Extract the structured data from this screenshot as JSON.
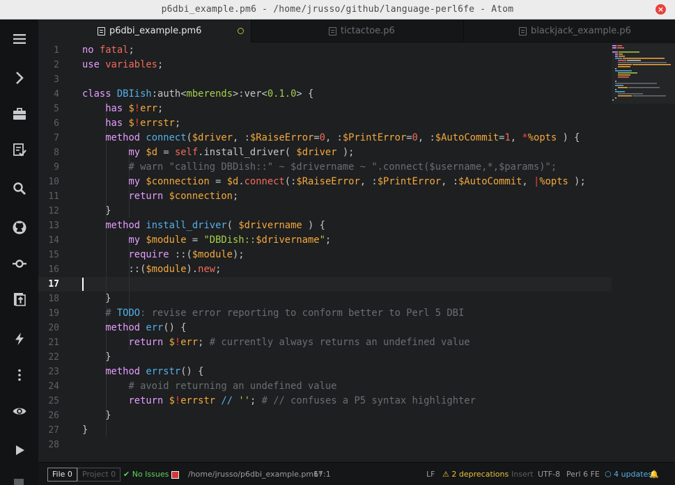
{
  "window": {
    "title": "p6dbi_example.pm6 - /home/jrusso/github/language-perl6fe - Atom"
  },
  "tabs": [
    {
      "label": "p6dbi_example.pm6"
    },
    {
      "label": "tictactoe.p6"
    },
    {
      "label": "blackjack_example.p6"
    }
  ],
  "editor": {
    "cursor_line": 17,
    "line_numbers": [
      "1",
      "2",
      "3",
      "4",
      "5",
      "6",
      "7",
      "8",
      "9",
      "10",
      "11",
      "12",
      "13",
      "14",
      "15",
      "16",
      "17",
      "18",
      "19",
      "20",
      "21",
      "22",
      "23",
      "24",
      "25",
      "26",
      "27",
      "28"
    ],
    "lines": [
      [
        [
          "k",
          "no"
        ],
        [
          "p",
          " "
        ],
        [
          "s",
          "fatal"
        ],
        [
          "p",
          ";"
        ]
      ],
      [
        [
          "k",
          "use"
        ],
        [
          "p",
          " "
        ],
        [
          "s",
          "variables"
        ],
        [
          "p",
          ";"
        ]
      ],
      [],
      [
        [
          "k",
          "class"
        ],
        [
          "p",
          " "
        ],
        [
          "t",
          "DBIish"
        ],
        [
          "p",
          ":auth<"
        ],
        [
          "g",
          "mberends"
        ],
        [
          "p",
          ">:ver<"
        ],
        [
          "g",
          "0.1.0"
        ],
        [
          "p",
          "> {"
        ]
      ],
      [
        [
          "p",
          "    "
        ],
        [
          "k",
          "has"
        ],
        [
          "p",
          " "
        ],
        [
          "v",
          "$"
        ],
        [
          "n",
          "!"
        ],
        [
          "v",
          "err"
        ],
        [
          "p",
          ";"
        ]
      ],
      [
        [
          "p",
          "    "
        ],
        [
          "k",
          "has"
        ],
        [
          "p",
          " "
        ],
        [
          "v",
          "$"
        ],
        [
          "n",
          "!"
        ],
        [
          "v",
          "errstr"
        ],
        [
          "p",
          ";"
        ]
      ],
      [
        [
          "p",
          "    "
        ],
        [
          "k",
          "method"
        ],
        [
          "p",
          " "
        ],
        [
          "f",
          "connect"
        ],
        [
          "p",
          "("
        ],
        [
          "v",
          "$driver"
        ],
        [
          "p",
          ", :"
        ],
        [
          "v",
          "$RaiseError"
        ],
        [
          "p",
          "="
        ],
        [
          "s",
          "0"
        ],
        [
          "p",
          ", :"
        ],
        [
          "v",
          "$PrintError"
        ],
        [
          "p",
          "="
        ],
        [
          "s",
          "0"
        ],
        [
          "p",
          ", :"
        ],
        [
          "v",
          "$AutoCommit"
        ],
        [
          "p",
          "="
        ],
        [
          "s",
          "1"
        ],
        [
          "p",
          ", "
        ],
        [
          "n",
          "*"
        ],
        [
          "v",
          "%opts"
        ],
        [
          "p",
          " ) {"
        ]
      ],
      [
        [
          "p",
          "        "
        ],
        [
          "k",
          "my"
        ],
        [
          "p",
          " "
        ],
        [
          "v",
          "$d"
        ],
        [
          "p",
          " = "
        ],
        [
          "s",
          "self"
        ],
        [
          "p",
          "."
        ],
        [
          "p",
          "install_driver( "
        ],
        [
          "v",
          "$driver"
        ],
        [
          "p",
          " );"
        ]
      ],
      [
        [
          "p",
          "        "
        ],
        [
          "c",
          "# warn \"calling DBDish::\" ~ $drivername ~ \".connect($username,*,$params)\";"
        ]
      ],
      [
        [
          "p",
          "        "
        ],
        [
          "k",
          "my"
        ],
        [
          "p",
          " "
        ],
        [
          "v",
          "$connection"
        ],
        [
          "p",
          " = "
        ],
        [
          "v",
          "$d"
        ],
        [
          "p",
          "."
        ],
        [
          "s",
          "connect"
        ],
        [
          "p",
          "(:"
        ],
        [
          "v",
          "$RaiseError"
        ],
        [
          "p",
          ", :"
        ],
        [
          "v",
          "$PrintError"
        ],
        [
          "p",
          ", :"
        ],
        [
          "v",
          "$AutoCommit"
        ],
        [
          "p",
          ", "
        ],
        [
          "n",
          "|"
        ],
        [
          "v",
          "%opts"
        ],
        [
          "p",
          " );"
        ]
      ],
      [
        [
          "p",
          "        "
        ],
        [
          "k",
          "return"
        ],
        [
          "p",
          " "
        ],
        [
          "v",
          "$connection"
        ],
        [
          "p",
          ";"
        ]
      ],
      [
        [
          "p",
          "    }"
        ]
      ],
      [
        [
          "p",
          "    "
        ],
        [
          "k",
          "method"
        ],
        [
          "p",
          " "
        ],
        [
          "f",
          "install_driver"
        ],
        [
          "p",
          "( "
        ],
        [
          "v",
          "$drivername"
        ],
        [
          "p",
          " ) {"
        ]
      ],
      [
        [
          "p",
          "        "
        ],
        [
          "k",
          "my"
        ],
        [
          "p",
          " "
        ],
        [
          "v",
          "$module"
        ],
        [
          "p",
          " = "
        ],
        [
          "g",
          "\"DBDish::"
        ],
        [
          "v",
          "$drivername"
        ],
        [
          "g",
          "\""
        ],
        [
          "p",
          ";"
        ]
      ],
      [
        [
          "p",
          "        "
        ],
        [
          "k",
          "require"
        ],
        [
          "p",
          " ::("
        ],
        [
          "v",
          "$module"
        ],
        [
          "p",
          ");"
        ]
      ],
      [
        [
          "p",
          "        ::("
        ],
        [
          "v",
          "$module"
        ],
        [
          "p",
          ")."
        ],
        [
          "s",
          "new"
        ],
        [
          "p",
          ";"
        ]
      ],
      [],
      [
        [
          "p",
          "    }"
        ]
      ],
      [
        [
          "p",
          "    "
        ],
        [
          "c",
          "# "
        ],
        [
          "f",
          "TODO"
        ],
        [
          "c",
          ": revise error reporting to conform better to Perl 5 DBI"
        ]
      ],
      [
        [
          "p",
          "    "
        ],
        [
          "k",
          "method"
        ],
        [
          "p",
          " "
        ],
        [
          "f",
          "err"
        ],
        [
          "p",
          "() {"
        ]
      ],
      [
        [
          "p",
          "        "
        ],
        [
          "k",
          "return"
        ],
        [
          "p",
          " "
        ],
        [
          "v",
          "$"
        ],
        [
          "n",
          "!"
        ],
        [
          "v",
          "err"
        ],
        [
          "p",
          "; "
        ],
        [
          "c",
          "# currently always returns an undefined value"
        ]
      ],
      [
        [
          "p",
          "    }"
        ]
      ],
      [
        [
          "p",
          "    "
        ],
        [
          "k",
          "method"
        ],
        [
          "p",
          " "
        ],
        [
          "f",
          "errstr"
        ],
        [
          "p",
          "() {"
        ]
      ],
      [
        [
          "p",
          "        "
        ],
        [
          "c",
          "# avoid returning an undefined value"
        ]
      ],
      [
        [
          "p",
          "        "
        ],
        [
          "k",
          "return"
        ],
        [
          "p",
          " "
        ],
        [
          "v",
          "$"
        ],
        [
          "n",
          "!"
        ],
        [
          "v",
          "errstr"
        ],
        [
          "p",
          " "
        ],
        [
          "f",
          "//"
        ],
        [
          "p",
          " "
        ],
        [
          "g",
          "''"
        ],
        [
          "p",
          "; "
        ],
        [
          "c",
          "# // confuses a P5 syntax highlighter"
        ]
      ],
      [
        [
          "p",
          "    }"
        ]
      ],
      [
        [
          "p",
          "}"
        ]
      ],
      []
    ]
  },
  "statusbar": {
    "file_label": "File",
    "file_count": "0",
    "project_label": "Project",
    "project_count": "0",
    "no_issues": "No Issues",
    "path": "/home/jrusso/p6dbi_example.pm6*",
    "cursor_pos": "17:1",
    "line_ending": "LF",
    "deprecations": "2 deprecations",
    "mode": "Insert",
    "encoding": "UTF-8",
    "grammar": "Perl 6 FE",
    "updates": "4 updates"
  },
  "colors": {
    "keyword": "#e79dff",
    "string_like": "#f26b5b",
    "variable": "#f5a93b",
    "function": "#56b0e8",
    "literal": "#a8d04a",
    "twigil": "#ff3f3f",
    "comment": "#6b6f72",
    "warning": "#e8c23a",
    "success": "#5ed35e"
  },
  "icons": {
    "toolbar": [
      "menu-icon",
      "chevron-right-icon",
      "briefcase-icon",
      "checklist-icon",
      "search-icon",
      "github-icon",
      "git-commit-icon",
      "upload-icon",
      "bolt-icon",
      "more-vertical-icon",
      "eye-icon",
      "play-icon"
    ]
  }
}
